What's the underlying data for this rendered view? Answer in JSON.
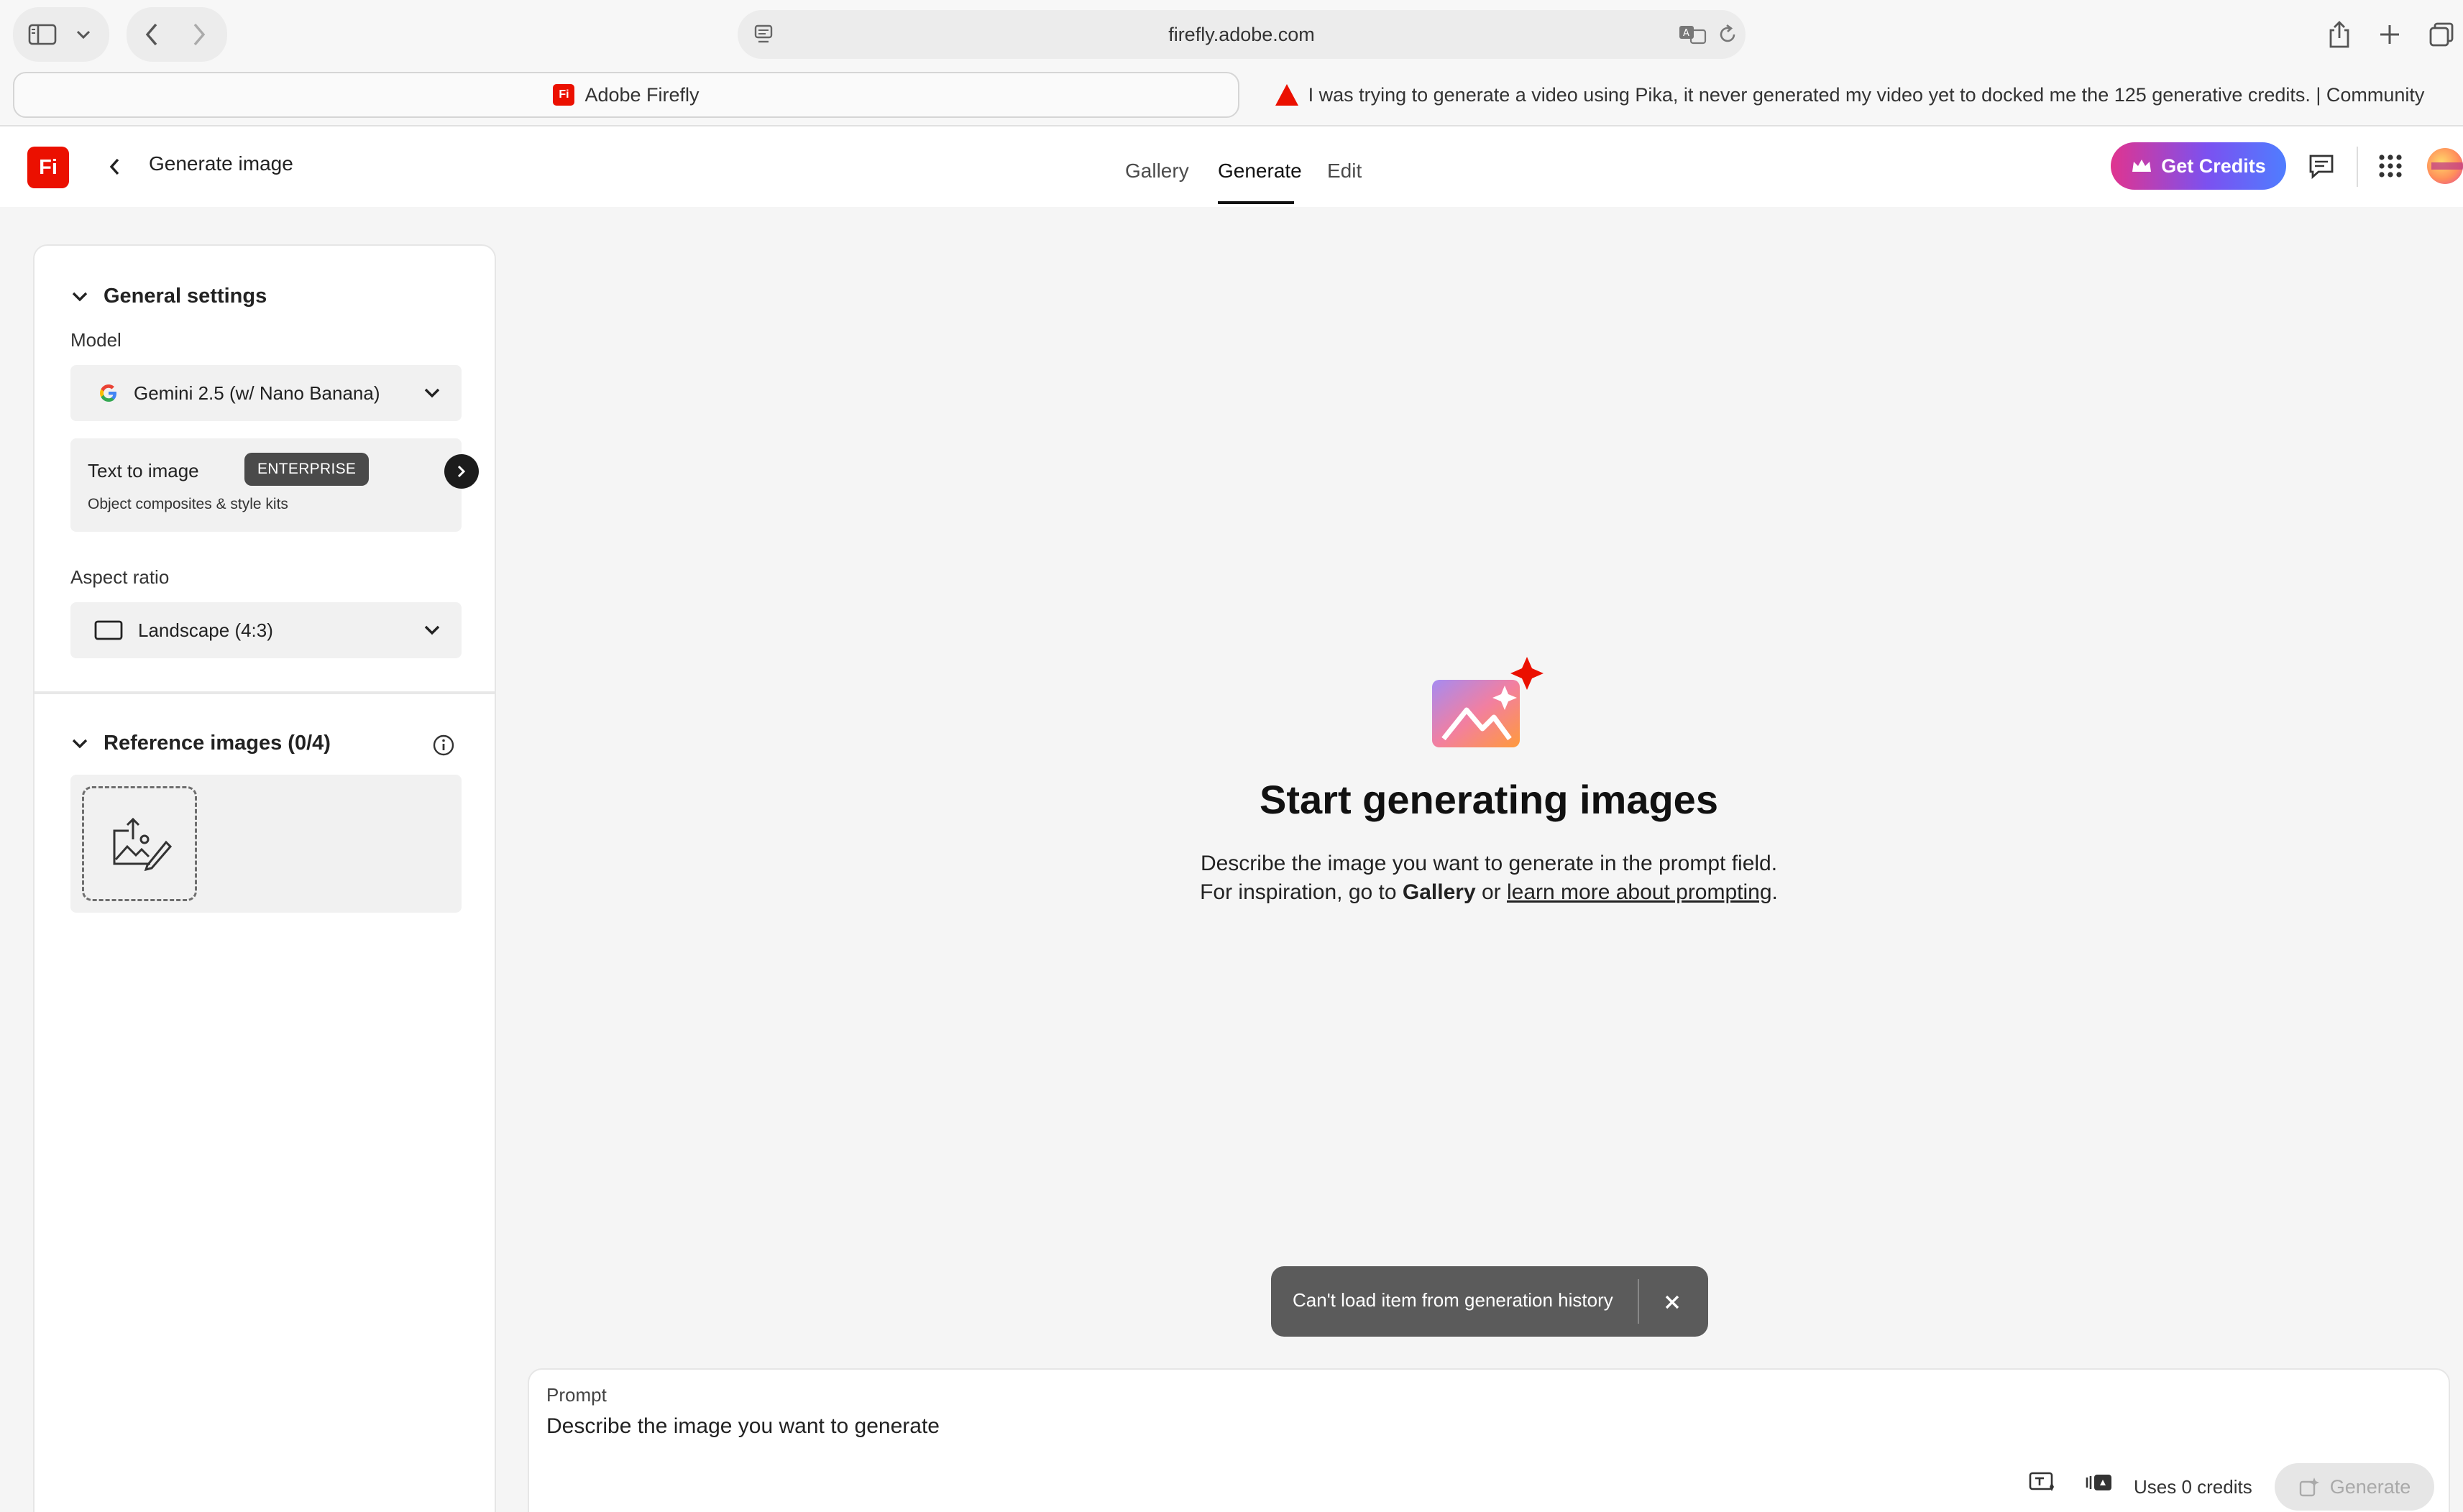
{
  "browser": {
    "url": "firefly.adobe.com",
    "tabs": [
      {
        "label": "Adobe Firefly",
        "icon": "firefly-logo-icon"
      },
      {
        "label": "I was trying to generate a video using Pika, it never generated my video yet to docked me the 125 generative credits. | Community",
        "icon": "adobe-logo-icon"
      }
    ]
  },
  "header": {
    "logo_text": "Fi",
    "title": "Generate image",
    "nav": [
      "Gallery",
      "Generate",
      "Edit"
    ],
    "active_nav": "Generate",
    "get_credits": "Get Credits"
  },
  "sidebar": {
    "general_settings": {
      "title": "General settings",
      "model_label": "Model",
      "model_value": "Gemini 2.5 (w/ Nano Banana)",
      "feature_title": "Text to image",
      "feature_badge": "ENTERPRISE",
      "feature_subtitle": "Object composites & style kits",
      "aspect_label": "Aspect ratio",
      "aspect_value": "Landscape (4:3)"
    },
    "reference_images": {
      "title": "Reference images (0/4)"
    }
  },
  "empty_state": {
    "title": "Start generating images",
    "line1": "Describe the image you want to generate in the prompt field.",
    "line2_prefix": "For inspiration, go to ",
    "line2_gallery": "Gallery",
    "line2_mid": " or ",
    "line2_link": "learn more about prompting",
    "line2_suffix": "."
  },
  "toast": {
    "message": "Can't load item from generation history"
  },
  "prompt": {
    "label": "Prompt",
    "placeholder": "Describe the image you want to generate",
    "credits": "Uses 0 credits",
    "generate": "Generate"
  },
  "colors": {
    "brand_red": "#eb1000",
    "credits_gradient_start": "#e0348f",
    "credits_gradient_end": "#4f7dff"
  }
}
